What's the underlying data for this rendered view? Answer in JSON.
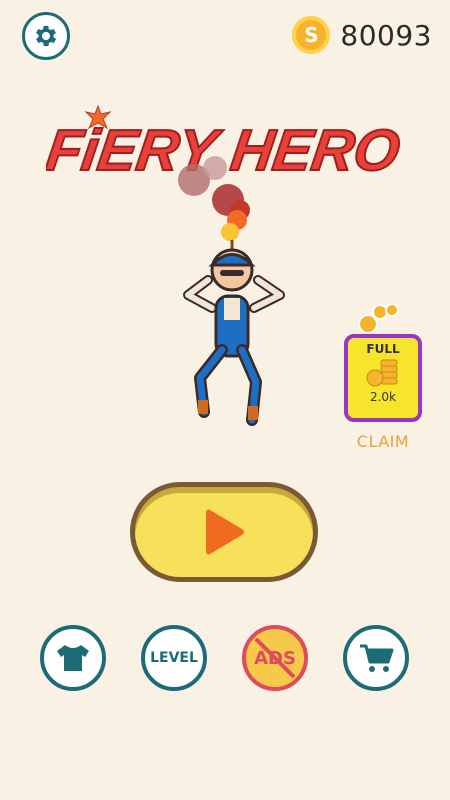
{
  "header": {
    "coin_count": "80093",
    "coin_symbol": "S"
  },
  "logo": {
    "title": "FiERY HERO"
  },
  "offer": {
    "full_label": "FULL",
    "amount": "2.0k",
    "claim_label": "CLAIM"
  },
  "bottom_menu": {
    "level_label": "LEVEL",
    "ads_label": "ADS"
  },
  "colors": {
    "background": "#f8f1e4",
    "teal": "#1e6b78",
    "play_yellow": "#f7e15a",
    "play_orange": "#f06a22",
    "logo_red": "#e8413b",
    "claim_orange": "#e8a23a",
    "offer_border": "#9b35c8"
  },
  "icons": [
    "gear-icon",
    "coin-icon",
    "play-icon",
    "shirt-icon",
    "no-ads-icon",
    "cart-icon"
  ]
}
